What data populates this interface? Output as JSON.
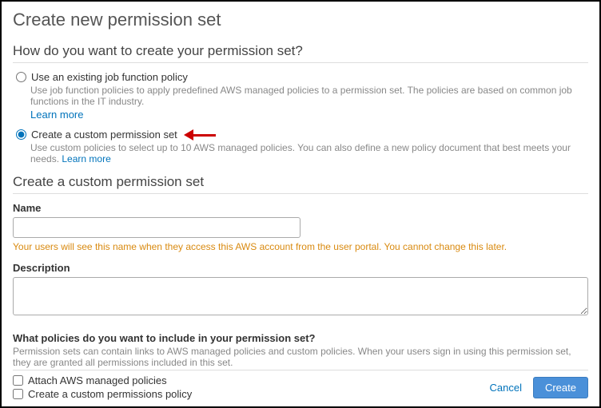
{
  "page": {
    "title": "Create new permission set",
    "question": "How do you want to create your permission set?"
  },
  "options": {
    "existing": {
      "label": "Use an existing job function policy",
      "desc": "Use job function policies to apply predefined AWS managed policies to a permission set. The policies are based on common job functions in the IT industry.",
      "learn_more": "Learn more"
    },
    "custom": {
      "label": "Create a custom permission set",
      "desc": "Use custom policies to select up to 10 AWS managed policies. You can also define a new policy document that best meets your needs.",
      "learn_more": "Learn more"
    }
  },
  "form": {
    "heading": "Create a custom permission set",
    "name_label": "Name",
    "name_hint": "Your users will see this name when they access this AWS account from the user portal. You cannot change this later.",
    "desc_label": "Description"
  },
  "policies": {
    "question": "What policies do you want to include in your permission set?",
    "hint": "Permission sets can contain links to AWS managed policies and custom policies. When your users sign in using this permission set, they are granted all permissions included in this set.",
    "attach_label": "Attach AWS managed policies",
    "create_label": "Create a custom permissions policy"
  },
  "footer": {
    "cancel": "Cancel",
    "create": "Create"
  }
}
